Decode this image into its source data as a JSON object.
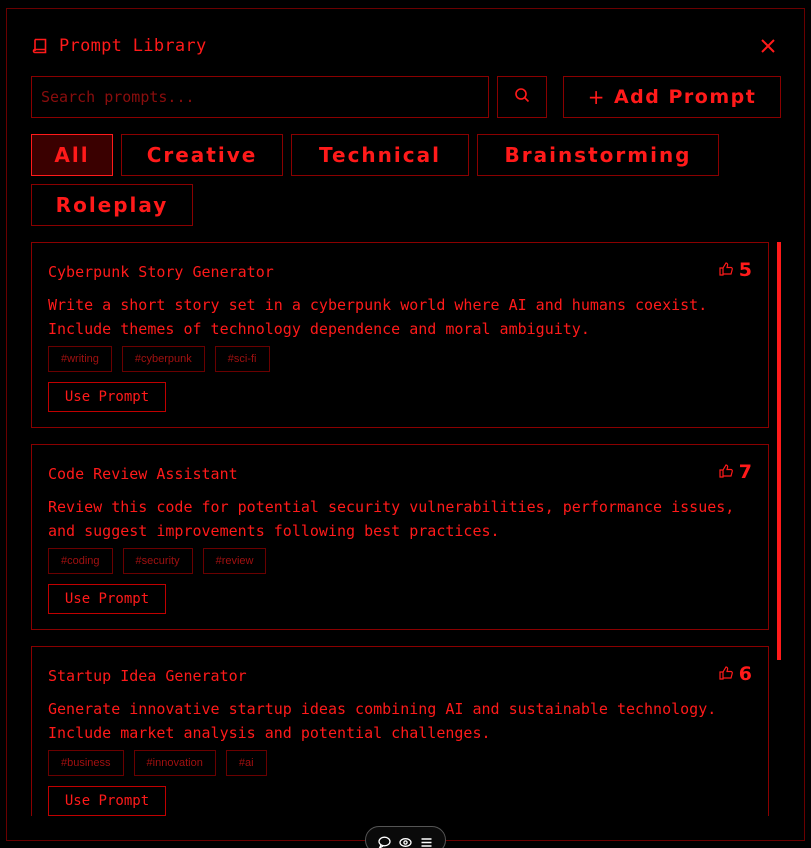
{
  "app": {
    "title": "Prompt Library"
  },
  "search": {
    "placeholder": "Search prompts...",
    "value": ""
  },
  "toolbar": {
    "add_label": "Add Prompt",
    "add_icon": "plus"
  },
  "filters": [
    {
      "label": "All",
      "active": true
    },
    {
      "label": "Creative",
      "active": false
    },
    {
      "label": "Technical",
      "active": false
    },
    {
      "label": "Brainstorming",
      "active": false
    },
    {
      "label": "Roleplay",
      "active": false
    }
  ],
  "prompts": [
    {
      "title": "Cyberpunk Story Generator",
      "likes": "5",
      "description": "Write a short story set in a cyberpunk world where AI and humans coexist. Include themes of technology dependence and moral ambiguity.",
      "tags": [
        "#writing",
        "#cyberpunk",
        "#sci-fi"
      ],
      "action": "Use Prompt"
    },
    {
      "title": "Code Review Assistant",
      "likes": "7",
      "description": "Review this code for potential security vulnerabilities, performance issues, and suggest improvements following best practices.",
      "tags": [
        "#coding",
        "#security",
        "#review"
      ],
      "action": "Use Prompt"
    },
    {
      "title": "Startup Idea Generator",
      "likes": "6",
      "description": "Generate innovative startup ideas combining AI and sustainable technology. Include market analysis and potential challenges.",
      "tags": [
        "#business",
        "#innovation",
        "#ai"
      ],
      "action": "Use Prompt"
    }
  ],
  "colors": {
    "accent": "#ff1a1a",
    "border": "#8a0000",
    "background": "#000000"
  },
  "icons": {
    "header": "book-icon",
    "close": "close-icon",
    "search": "search-icon",
    "like": "thumbs-up-icon",
    "dock": [
      "chat-icon",
      "eye-icon",
      "menu-icon"
    ]
  }
}
